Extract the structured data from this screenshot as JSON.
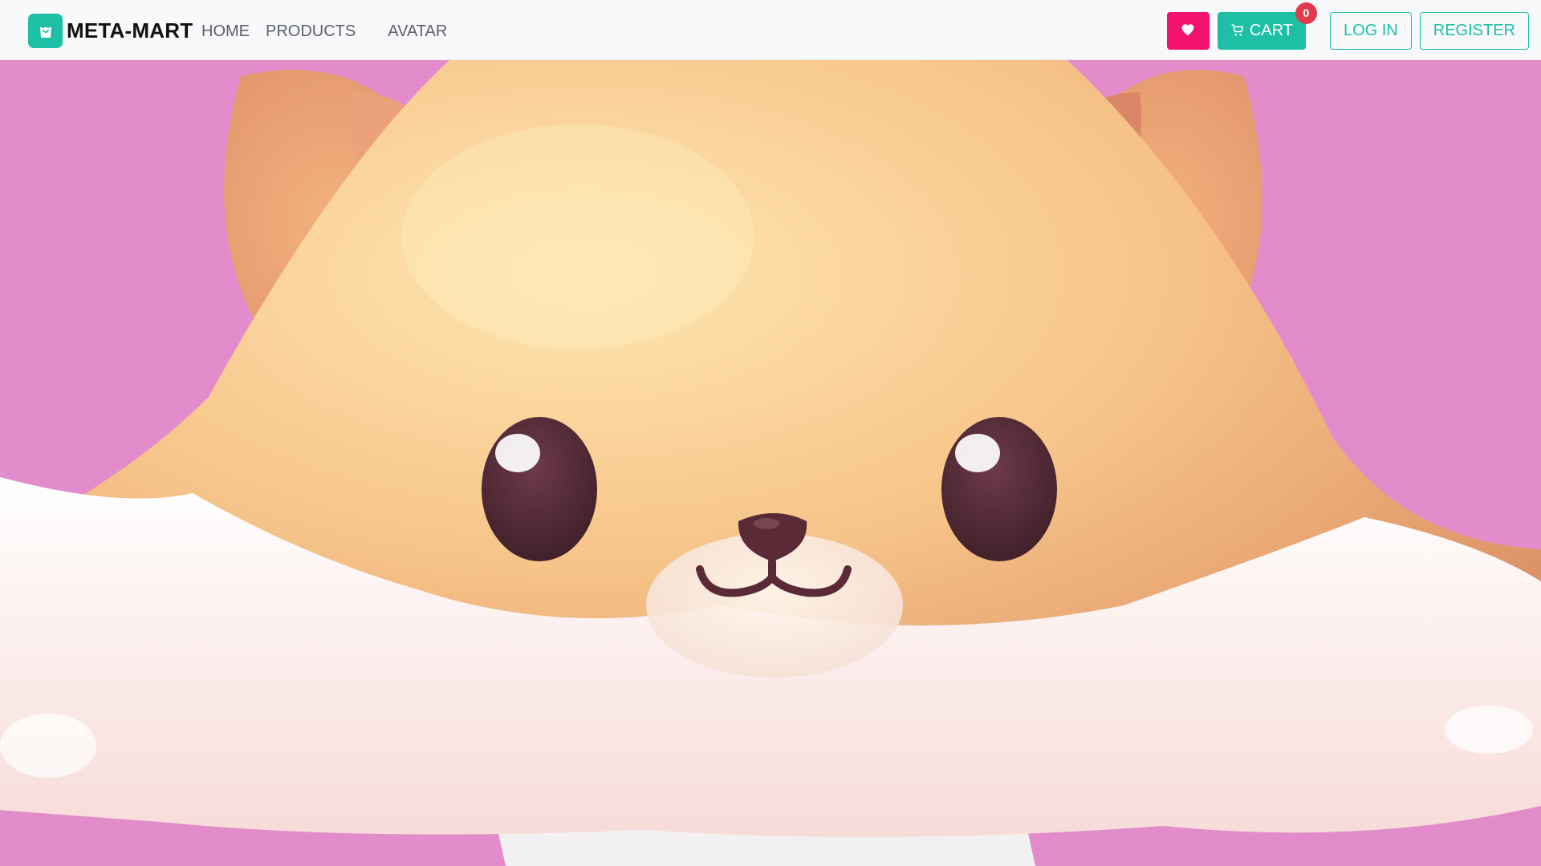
{
  "brand": {
    "name": "META-MART",
    "logo_icon": "shopping-bag-icon"
  },
  "nav": {
    "links": [
      {
        "label": "HOME"
      },
      {
        "label": "PRODUCTS"
      },
      {
        "label": "AVATAR"
      }
    ]
  },
  "actions": {
    "favorites_icon": "heart-icon",
    "cart_label": "CART",
    "cart_icon": "cart-icon",
    "cart_count": "0",
    "login_label": "LOG IN",
    "register_label": "REGISTER"
  },
  "colors": {
    "accent": "#1fbfa6",
    "favorites": "#f21371",
    "badge": "#e03a4c",
    "hero_background": "#e38ccb"
  }
}
